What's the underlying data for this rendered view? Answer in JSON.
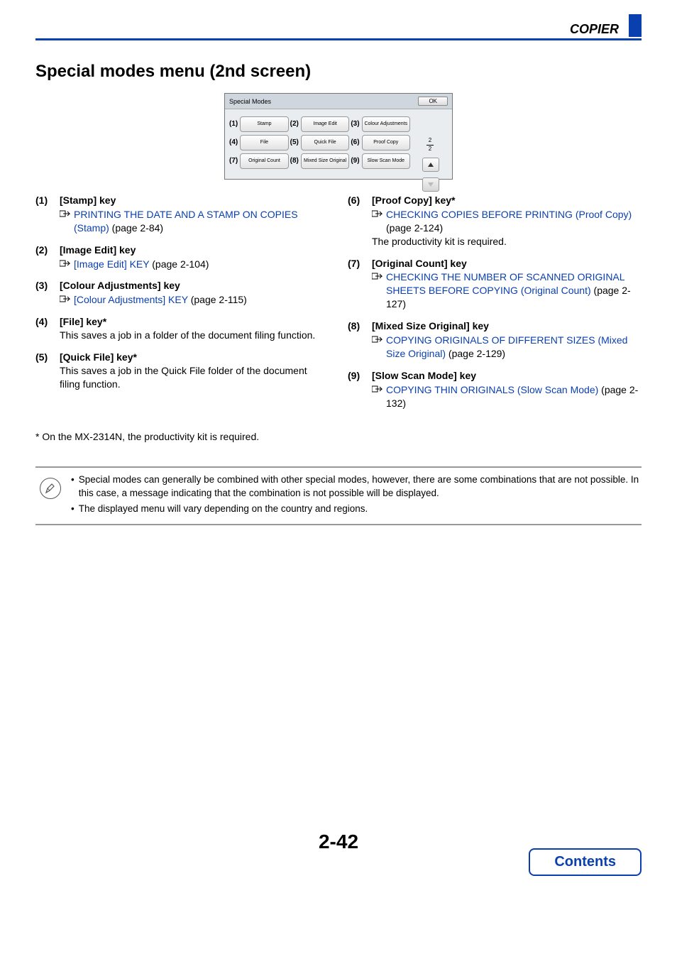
{
  "header": {
    "section": "COPIER"
  },
  "title": "Special modes menu (2nd screen)",
  "panel": {
    "tab_label": "Special Modes",
    "ok": "OK",
    "buttons": [
      [
        {
          "num": "(1)",
          "label": "Stamp"
        },
        {
          "num": "(2)",
          "label": "Image Edit"
        },
        {
          "num": "(3)",
          "label": "Colour Adjustments"
        }
      ],
      [
        {
          "num": "(4)",
          "label": "File"
        },
        {
          "num": "(5)",
          "label": "Quick File"
        },
        {
          "num": "(6)",
          "label": "Proof Copy"
        }
      ],
      [
        {
          "num": "(7)",
          "label": "Original Count"
        },
        {
          "num": "(8)",
          "label": "Mixed Size Original"
        },
        {
          "num": "(9)",
          "label": "Slow Scan Mode"
        }
      ]
    ],
    "page_indicator": {
      "current": "2",
      "total": "2"
    }
  },
  "left_items": [
    {
      "num": "(1)",
      "title": "[Stamp] key",
      "link": "PRINTING THE DATE AND A STAMP ON COPIES (Stamp)",
      "page": " (page 2-84)"
    },
    {
      "num": "(2)",
      "title": "[Image Edit] key",
      "link": "[Image Edit] KEY",
      "page": " (page 2-104)"
    },
    {
      "num": "(3)",
      "title": "[Colour Adjustments] key",
      "link": "[Colour Adjustments] KEY",
      "page": " (page 2-115)"
    },
    {
      "num": "(4)",
      "title": "[File] key*",
      "desc": "This saves a job in a folder of the document filing function."
    },
    {
      "num": "(5)",
      "title": "[Quick File] key*",
      "desc": "This saves a job in the Quick File folder of the document filing function."
    }
  ],
  "right_items": [
    {
      "num": "(6)",
      "title": "[Proof Copy] key*",
      "link": "CHECKING COPIES BEFORE PRINTING (Proof Copy)",
      "page": " (page 2-124)",
      "desc": "The productivity kit is required."
    },
    {
      "num": "(7)",
      "title": "[Original Count] key",
      "link": "CHECKING THE NUMBER OF SCANNED ORIGINAL SHEETS BEFORE COPYING (Original Count)",
      "page": " (page 2-127)"
    },
    {
      "num": "(8)",
      "title": "[Mixed Size Original] key",
      "link": "COPYING ORIGINALS OF DIFFERENT SIZES (Mixed Size Original)",
      "page": " (page 2-129)"
    },
    {
      "num": "(9)",
      "title": "[Slow Scan Mode] key",
      "link": "COPYING THIN ORIGINALS (Slow Scan Mode)",
      "page": " (page 2-132)"
    }
  ],
  "footnote": "* On the MX-2314N, the productivity kit is required.",
  "notes": [
    "Special modes can generally be combined with other special modes, however, there are some combinations that are not possible. In this case, a message indicating that the combination is not possible will be displayed.",
    "The displayed menu will vary depending on the country and regions."
  ],
  "page_number": "2-42",
  "contents_label": "Contents"
}
